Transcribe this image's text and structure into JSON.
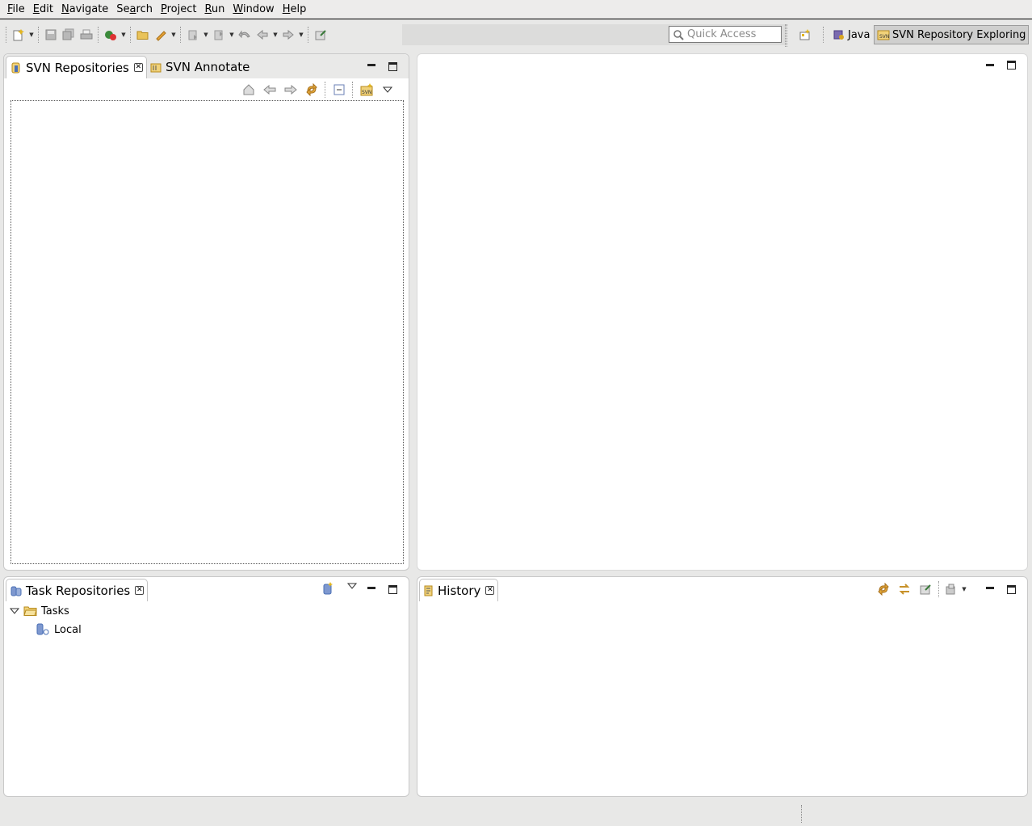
{
  "menubar": {
    "items": [
      {
        "pre": "",
        "u": "F",
        "post": "ile"
      },
      {
        "pre": "",
        "u": "E",
        "post": "dit"
      },
      {
        "pre": "",
        "u": "N",
        "post": "avigate"
      },
      {
        "pre": "Se",
        "u": "a",
        "post": "rch"
      },
      {
        "pre": "",
        "u": "P",
        "post": "roject"
      },
      {
        "pre": "",
        "u": "R",
        "post": "un"
      },
      {
        "pre": "",
        "u": "W",
        "post": "indow"
      },
      {
        "pre": "",
        "u": "H",
        "post": "elp"
      }
    ]
  },
  "toolbar": {
    "quick_access_placeholder": "Quick Access",
    "perspectives": {
      "java": "Java",
      "svn_exploring": "SVN Repository Exploring"
    }
  },
  "svn_panel": {
    "tab_repositories": "SVN Repositories",
    "tab_annotate": "SVN Annotate"
  },
  "task_panel": {
    "tab_label": "Task Repositories",
    "tree": {
      "root": "Tasks",
      "child": "Local"
    }
  },
  "history_panel": {
    "tab_label": "History"
  },
  "colors": {
    "folder": "#d9a520",
    "repo_blue": "#4a6fb5",
    "arrow_gold": "#c8922a"
  }
}
